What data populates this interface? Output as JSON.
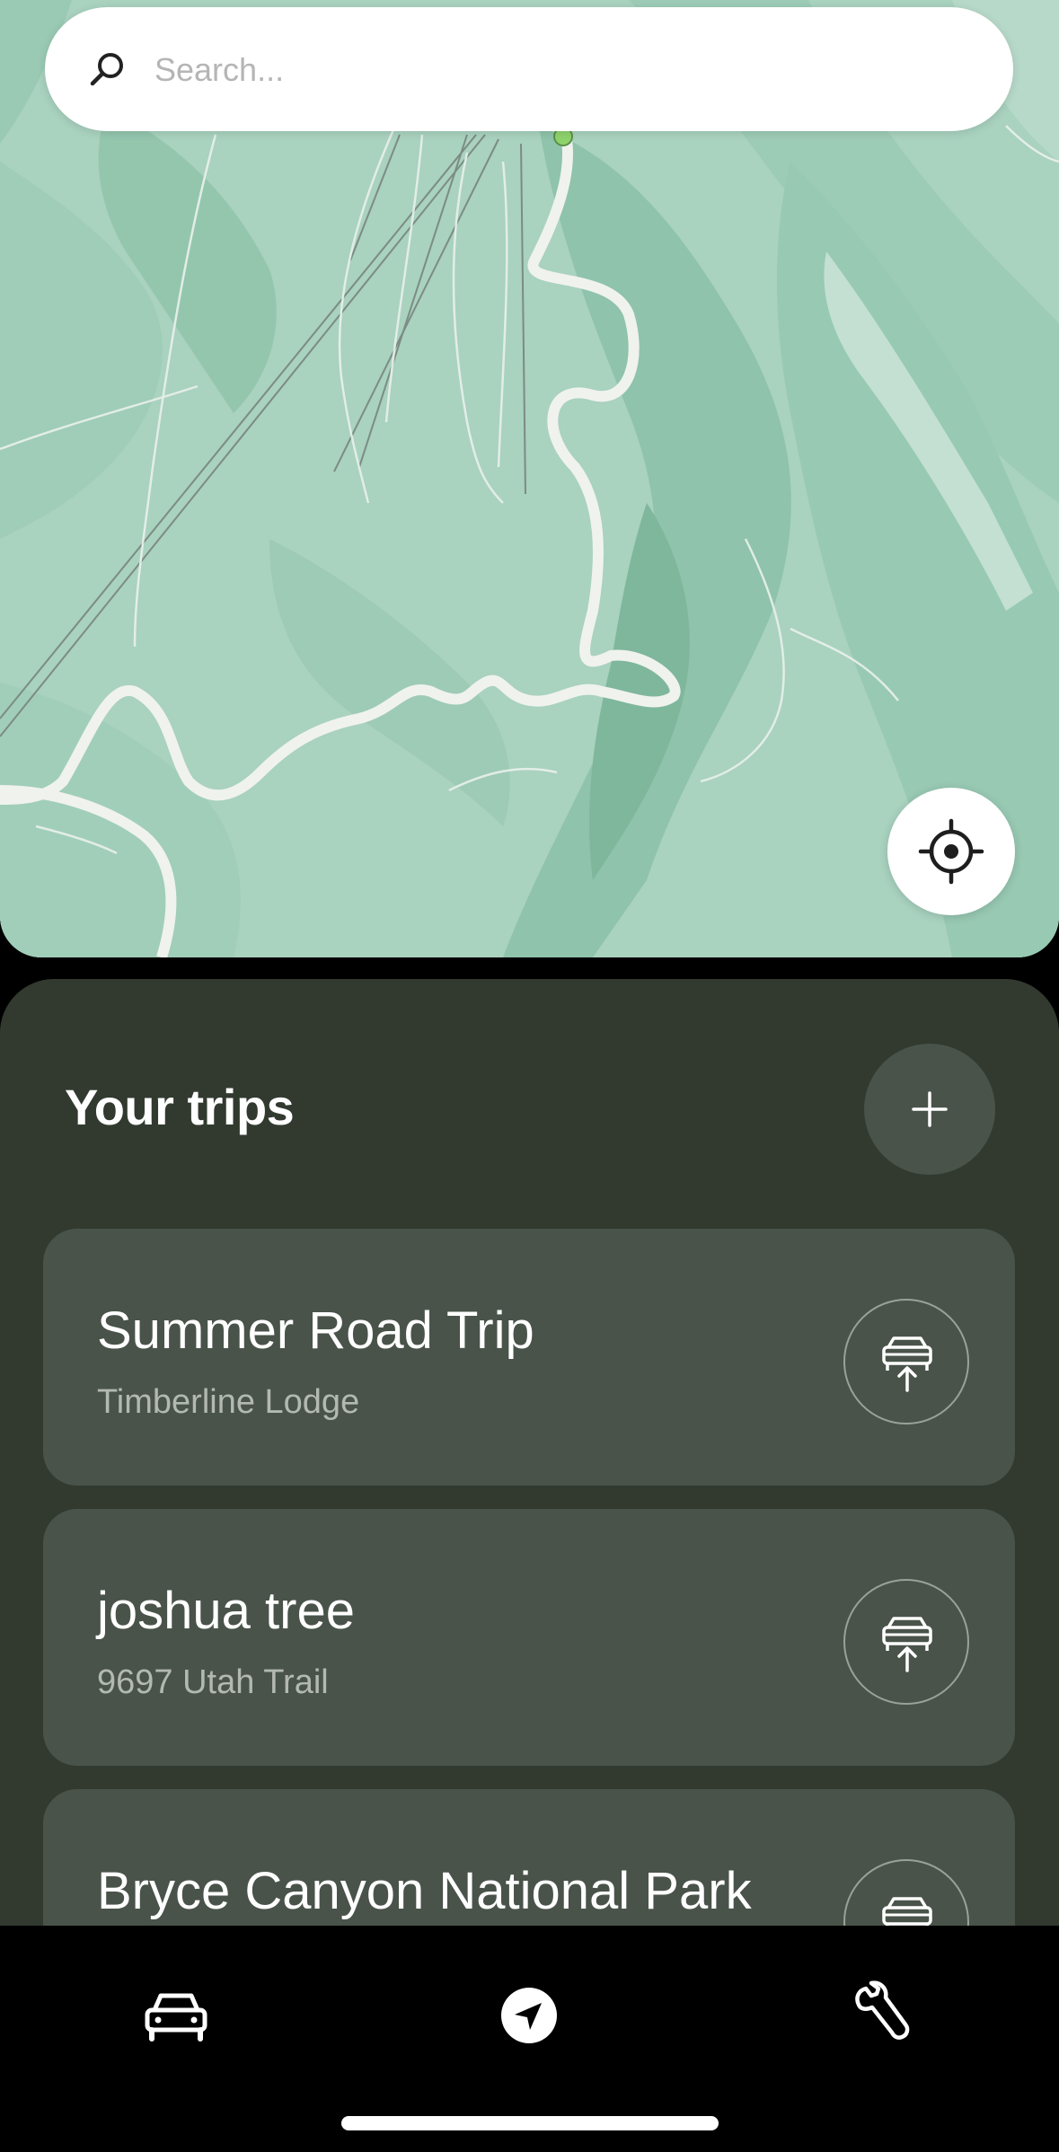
{
  "map": {
    "search": {
      "placeholder": "Search..."
    },
    "colors": {
      "land": "#a9d2bf",
      "forest": "#8fc3ab",
      "road": "#f1f3ef",
      "marker": "#8ed36c"
    }
  },
  "trips_panel": {
    "title": "Your trips",
    "trips": [
      {
        "name": "Summer Road Trip",
        "location": "Timberline Lodge"
      },
      {
        "name": "joshua tree",
        "location": "9697 Utah Trail"
      },
      {
        "name": "Bryce Canyon National Park",
        "location": ""
      }
    ]
  },
  "bottom_nav": {
    "items": [
      {
        "icon": "car-icon"
      },
      {
        "icon": "navigation-arrow-icon"
      },
      {
        "icon": "wrench-icon"
      }
    ]
  }
}
